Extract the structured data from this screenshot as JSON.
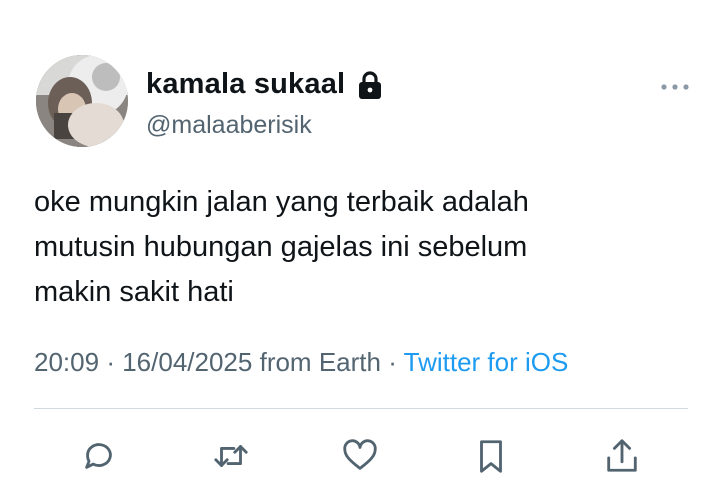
{
  "user": {
    "display_name": "kamala sukaal",
    "handle": "@malaaberisik",
    "protected": true
  },
  "tweet": {
    "text": "oke mungkin jalan yang terbaik adalah\nmutusin hubungan gajelas ini sebelum\nmakin sakit hati",
    "time": "20:09",
    "date": "16/04/2025",
    "location_text": "from Earth",
    "separator": "·",
    "source": "Twitter for iOS"
  },
  "icons": {
    "lock": "lock-icon",
    "more": "more-horizontal-icon",
    "reply": "reply-icon",
    "retweet": "retweet-icon",
    "like": "like-icon",
    "bookmark": "bookmark-icon",
    "share": "share-icon"
  },
  "colors": {
    "text": "#0f1419",
    "secondary": "#536471",
    "link": "#1d9bf0",
    "divider": "#cfd9de"
  }
}
